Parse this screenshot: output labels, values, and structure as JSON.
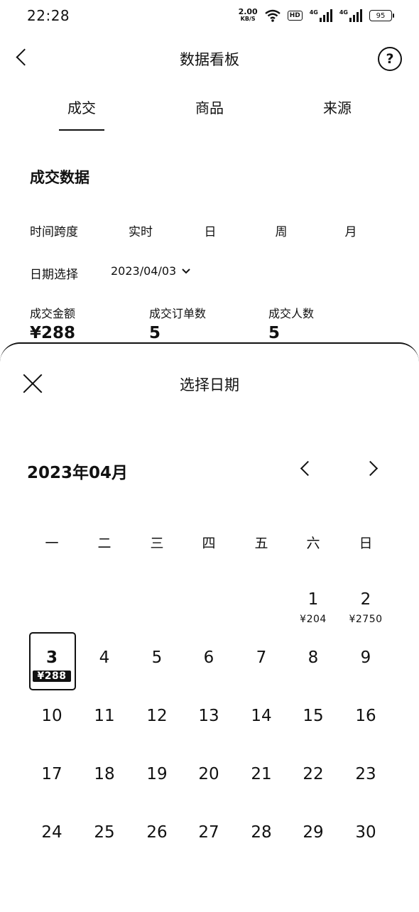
{
  "status": {
    "time": "22:28",
    "speed_value": "2.00",
    "speed_unit": "KB/S",
    "hd": "HD",
    "sig1": "4G",
    "sig2": "4G",
    "battery": "95"
  },
  "nav": {
    "title": "数据看板",
    "help": "?"
  },
  "tabs": [
    "成交",
    "商品",
    "来源"
  ],
  "section": {
    "title": "成交数据",
    "time_span_label": "时间跨度",
    "time_span_options": [
      "实时",
      "日",
      "周",
      "月"
    ],
    "date_label": "日期选择",
    "date_value": "2023/04/03",
    "metrics": [
      {
        "label": "成交金额",
        "value": "¥288"
      },
      {
        "label": "成交订单数",
        "value": "5"
      },
      {
        "label": "成交人数",
        "value": "5"
      }
    ]
  },
  "picker": {
    "title": "选择日期",
    "month": "2023年04月",
    "weekdays": [
      "一",
      "二",
      "三",
      "四",
      "五",
      "六",
      "日"
    ],
    "days": [
      {
        "day": "1",
        "amount": "¥204"
      },
      {
        "day": "2",
        "amount": "¥2750"
      },
      {
        "day": "3",
        "amount": "¥288",
        "selected": true
      },
      {
        "day": "4"
      },
      {
        "day": "5"
      },
      {
        "day": "6"
      },
      {
        "day": "7"
      },
      {
        "day": "8"
      },
      {
        "day": "9"
      },
      {
        "day": "10"
      },
      {
        "day": "11"
      },
      {
        "day": "12"
      },
      {
        "day": "13"
      },
      {
        "day": "14"
      },
      {
        "day": "15"
      },
      {
        "day": "16"
      },
      {
        "day": "17"
      },
      {
        "day": "18"
      },
      {
        "day": "19"
      },
      {
        "day": "20"
      },
      {
        "day": "21"
      },
      {
        "day": "22"
      },
      {
        "day": "23"
      },
      {
        "day": "24"
      },
      {
        "day": "25"
      },
      {
        "day": "26"
      },
      {
        "day": "27"
      },
      {
        "day": "28"
      },
      {
        "day": "29"
      },
      {
        "day": "30"
      }
    ]
  }
}
